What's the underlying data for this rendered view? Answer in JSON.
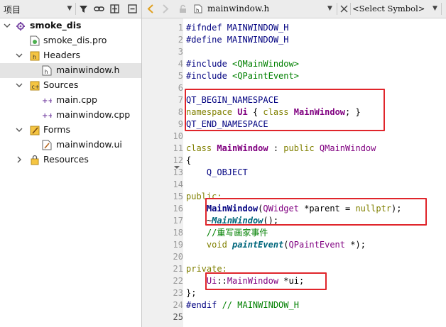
{
  "project_pane": {
    "title": "项目",
    "tree": [
      {
        "label": "smoke_dis",
        "bold": true
      },
      {
        "label": "smoke_dis.pro"
      },
      {
        "label": "Headers"
      },
      {
        "label": "mainwindow.h",
        "selected": true
      },
      {
        "label": "Sources"
      },
      {
        "label": "main.cpp"
      },
      {
        "label": "mainwindow.cpp"
      },
      {
        "label": "Forms"
      },
      {
        "label": "mainwindow.ui"
      },
      {
        "label": "Resources"
      }
    ]
  },
  "editor": {
    "file_name": "mainwindow.h",
    "symbol_selector": "<Select Symbol>",
    "line_numbers": [
      "1",
      "2",
      "3",
      "4",
      "5",
      "6",
      "7",
      "8",
      "9",
      "10",
      "11",
      "12",
      "13",
      "14",
      "15",
      "16",
      "17",
      "18",
      "19",
      "20",
      "21",
      "22",
      "23",
      "24",
      "25"
    ],
    "code": {
      "l1": "#ifndef MAINWINDOW_H",
      "l2": "#define MAINWINDOW_H",
      "l4_dir": "#include ",
      "l4_file": "<QMainWindow>",
      "l5_dir": "#include ",
      "l5_file": "<QPaintEvent>",
      "l7": "QT_BEGIN_NAMESPACE",
      "l8_kw": "namespace",
      "l8_ns": "Ui",
      "l8_open": " { ",
      "l8_kw2": "class",
      "l8_cls": "MainWindow",
      "l8_close": "; }",
      "l9": "QT_END_NAMESPACE",
      "l11_kw": "class",
      "l11_cls": "MainWindow",
      "l11_mid": " : ",
      "l11_kw2": "public",
      "l11_base": "QMainWindow",
      "l12": "{",
      "l13": "Q_OBJECT",
      "l15": "public:",
      "l16_fn": "MainWindow",
      "l16_p1": "(",
      "l16_type": "QWidget",
      "l16_p2": " *parent = ",
      "l16_null": "nullptr",
      "l16_p3": ");",
      "l17_tilde": "~",
      "l17_fn": "MainWindow",
      "l17_end": "();",
      "l18": "//重写画家事件",
      "l19_kw": "void",
      "l19_fn": "paintEvent",
      "l19_p1": "(",
      "l19_type": "QPaintEvent",
      "l19_p2": " *);",
      "l21": "private:",
      "l22_ns": "Ui",
      "l22_sep": "::",
      "l22_cls": "MainWindow",
      "l22_rest": " *ui;",
      "l23": "};",
      "l24_dir": "#endif ",
      "l24_cmt": "// MAINWINDOW_H"
    }
  }
}
